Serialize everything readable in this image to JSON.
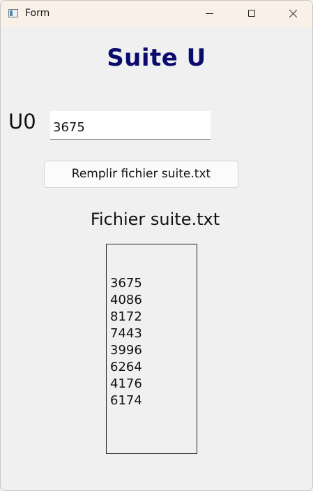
{
  "window": {
    "title": "Form",
    "app_icon": "form-window-icon",
    "controls": {
      "minimize_icon": "minimize-icon",
      "maximize_icon": "maximize-icon",
      "close_icon": "close-icon"
    }
  },
  "form": {
    "heading": "Suite U",
    "heading_color": "#0b0b6e",
    "u0_label": "U0",
    "u0_value": "3675",
    "fill_button_label": "Remplir fichier suite.txt",
    "file_label": "Fichier suite.txt",
    "file_lines": [
      "3675",
      "4086",
      "8172",
      "7443",
      "3996",
      "6264",
      "4176",
      "6174"
    ]
  }
}
